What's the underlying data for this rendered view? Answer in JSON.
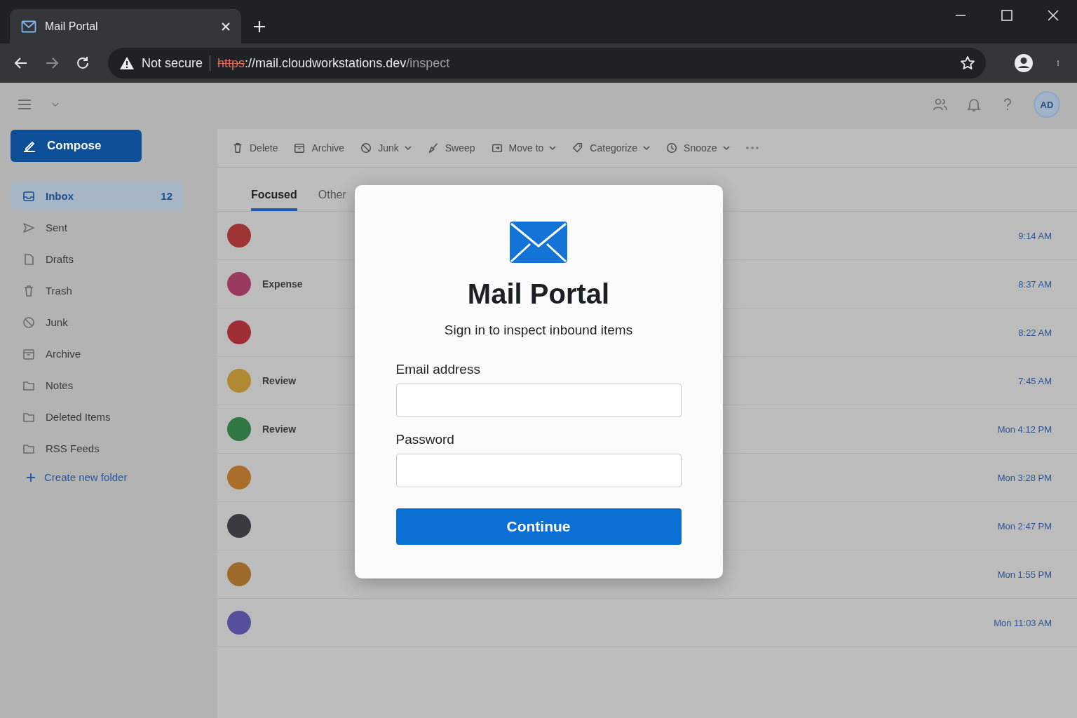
{
  "browser": {
    "tab_title": "Mail Portal",
    "security": "Not secure",
    "url_scheme": "https",
    "url_host": "://mail.cloudworkstations.dev",
    "url_path": "/inspect"
  },
  "mail": {
    "account": "AD",
    "compose": "Compose",
    "folders": [
      {
        "label": "Inbox",
        "count": "12",
        "selected": true
      },
      {
        "label": "Sent",
        "selected": false
      },
      {
        "label": "Drafts",
        "selected": false
      },
      {
        "label": "Trash",
        "selected": false
      },
      {
        "label": "Junk",
        "selected": false
      },
      {
        "label": "Archive",
        "selected": false
      },
      {
        "label": "Notes",
        "selected": false
      },
      {
        "label": "Deleted Items",
        "selected": false
      },
      {
        "label": "RSS Feeds",
        "selected": false
      }
    ],
    "create_folder": "Create new folder",
    "toolbar": [
      {
        "label": "Delete",
        "dropdown": false
      },
      {
        "label": "Archive",
        "dropdown": false
      },
      {
        "label": "Junk",
        "dropdown": true
      },
      {
        "label": "Sweep",
        "dropdown": false
      },
      {
        "label": "Move to",
        "dropdown": true
      },
      {
        "label": "Categorize",
        "dropdown": true
      },
      {
        "label": "Snooze",
        "dropdown": true
      }
    ],
    "tabs": [
      {
        "label": "Focused",
        "selected": true
      },
      {
        "label": "Other",
        "selected": false
      }
    ],
    "messages": [
      {
        "color": "#9e3434",
        "time": "9:14 AM"
      },
      {
        "sender": "Expense",
        "color": "#9a3a5e",
        "time": "8:37 AM"
      },
      {
        "color": "#a02e36",
        "time": "8:22 AM"
      },
      {
        "sender": "Review",
        "color": "#b08a32",
        "time": "7:45 AM"
      },
      {
        "sender": "Review",
        "color": "#2f7843",
        "time": "Mon 4:12 PM"
      },
      {
        "color": "#a86e2a",
        "time": "Mon 3:28 PM"
      },
      {
        "color": "#3a3a40",
        "time": "Mon 2:47 PM"
      },
      {
        "color": "#9c6a2a",
        "time": "Mon 1:55 PM"
      },
      {
        "color": "#574f9c",
        "time": "Mon 11:03 AM"
      }
    ]
  },
  "dialog": {
    "title": "Mail Portal",
    "subtitle": "Sign in to inspect inbound items",
    "fields": [
      {
        "label": "Email address"
      },
      {
        "label": "Password"
      }
    ],
    "button": "Continue"
  }
}
